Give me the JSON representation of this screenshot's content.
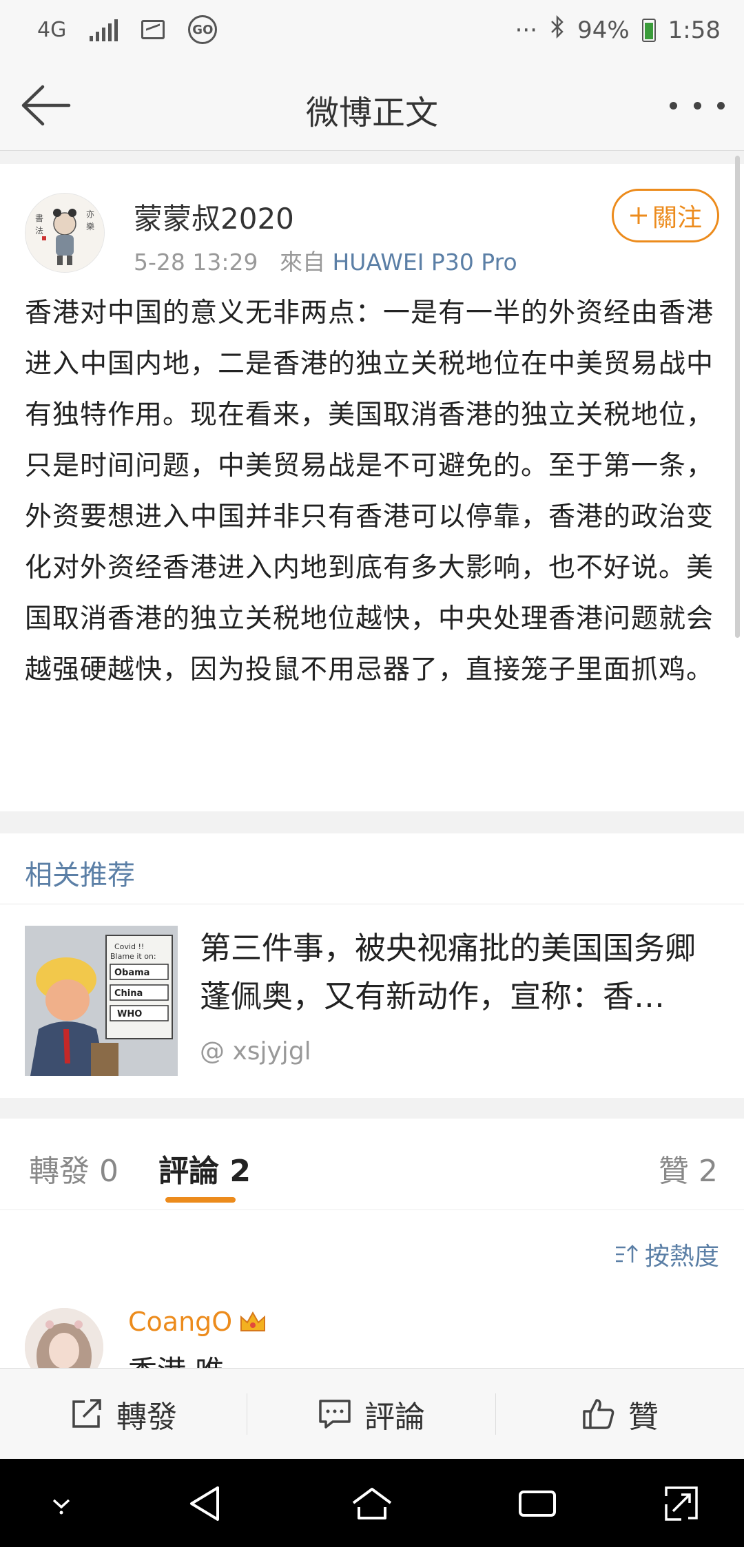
{
  "status_bar": {
    "network": "4G",
    "more": "···",
    "battery": "94%",
    "time": "1:58"
  },
  "header": {
    "title": "微博正文"
  },
  "post": {
    "username": "蒙蒙叔2020",
    "timestamp": "5-28 13:29",
    "source_prefix": "來自",
    "source": "HUAWEI P30 Pro",
    "follow_label": "關注",
    "text": "香港对中国的意义无非两点：一是有一半的外资经由香港进入中国内地，二是香港的独立关税地位在中美贸易战中有独特作用。现在看来，美国取消香港的独立关税地位，只是时间问题，中美贸易战是不可避免的。至于第一条，外资要想进入中国并非只有香港可以停靠，香港的政治变化对外资经香港进入内地到底有多大影响，也不好说。美国取消香港的独立关税地位越快，中央处理香港问题就会越强硬越快，因为投鼠不用忌器了，直接笼子里面抓鸡。"
  },
  "related": {
    "title": "相关推荐",
    "item_text": "第三件事，被央视痛批的美国国务卿蓬佩奥，又有新动作，宣称：香…",
    "item_user": "@ xsjyjgl",
    "thumb_labels": [
      "Covid !!",
      "Blame it on:",
      "Obama",
      "China",
      "WHO"
    ]
  },
  "tabs": {
    "repost": "轉發 0",
    "comment": "評論 2",
    "like": "贊 2"
  },
  "comments": {
    "sort_label": "按熱度",
    "first_user": "CoangO",
    "first_text": "香港 唯..."
  },
  "action_bar": {
    "repost": "轉發",
    "comment": "評論",
    "like": "贊"
  },
  "colors": {
    "accent": "#ec8b1c",
    "link": "#5b7fa6"
  }
}
